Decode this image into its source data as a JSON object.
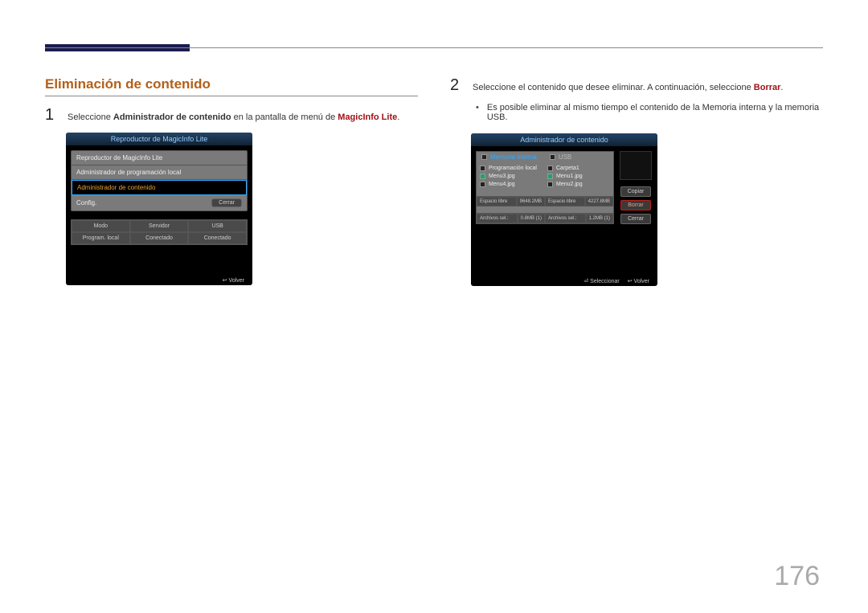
{
  "page_number": "176",
  "section_title": "Eliminación de contenido",
  "step1": {
    "num": "1",
    "pre": "Seleccione ",
    "bold": "Administrador de contenido",
    "mid": " en la pantalla de menú de ",
    "hl": "MagicInfo Lite",
    "post": "."
  },
  "step2": {
    "num": "2",
    "pre": "Seleccione el contenido que desee eliminar. A continuación, seleccione ",
    "hl": "Borrar",
    "post": "."
  },
  "bullet": {
    "pre": "Es posible eliminar al mismo tiempo el contenido de la ",
    "b1": "Memoria interna",
    "mid": " y la memoria ",
    "b2": "USB",
    "post": "."
  },
  "device1": {
    "title": "Reproductor de MagicInfo Lite",
    "menu": [
      "Reproductor de MagicInfo Lite",
      "Administrador de programación local",
      "Administrador de contenido",
      "Config."
    ],
    "close": "Cerrar",
    "status_headers": [
      "Modo",
      "Servidor",
      "USB"
    ],
    "status_values": [
      "Program. local",
      "Conectado",
      "Conectado"
    ],
    "footer": "↩ Volver"
  },
  "device2": {
    "title": "Administrador de contenido",
    "tab_internal": "Memoria interna",
    "tab_usb": "USB",
    "files_left": [
      {
        "name": "Programación local",
        "chk": false
      },
      {
        "name": "Menu3.jpg",
        "chk": true
      },
      {
        "name": "Menu4.jpg",
        "chk": false
      }
    ],
    "files_right": [
      {
        "name": "Carpeta1",
        "chk": false
      },
      {
        "name": "Menu1.jpg",
        "chk": true
      },
      {
        "name": "Menu2.jpg",
        "chk": false
      }
    ],
    "space_left_label": "Espacio libre",
    "space_left_val": "9648.2MB",
    "space_right_label": "Espacio libre",
    "space_right_val": "4227.8MB",
    "sel_left_label": "Archivos sel.:",
    "sel_left_val": "0.8MB (1)",
    "sel_right_label": "Archivos sel.:",
    "sel_right_val": "1.2MB (1)",
    "btn_copy": "Copiar",
    "btn_delete": "Borrar",
    "btn_close": "Cerrar",
    "footer_select": "⏎ Seleccionar",
    "footer_back": "↩ Volver"
  }
}
